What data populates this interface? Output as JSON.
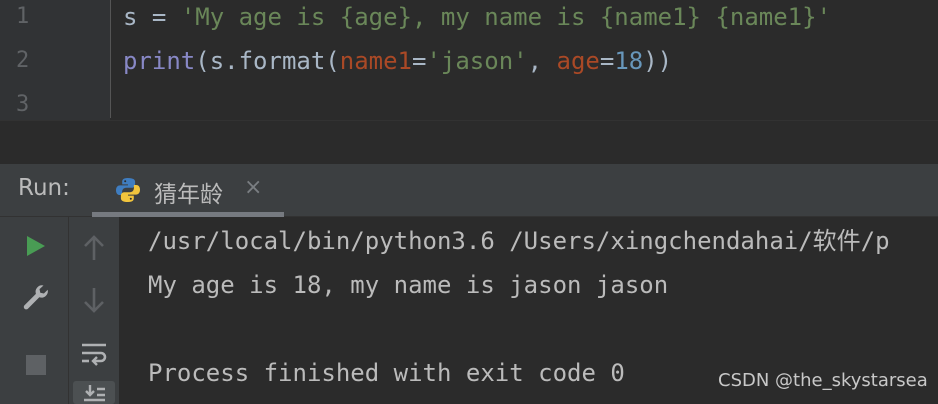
{
  "editor": {
    "line_numbers": [
      "1",
      "2",
      "3"
    ],
    "line1": {
      "var": "s",
      "op": " = ",
      "str": "'My age is {age}, my name is {name1} {name1}'"
    },
    "line2": {
      "func": "print",
      "p1": "(s.format(",
      "kw1": "name1",
      "eq1": "=",
      "str1": "'jason'",
      "comma": ", ",
      "kw2": "age",
      "eq2": "=",
      "num": "18",
      "close": "))"
    }
  },
  "run_window": {
    "title": "Run:",
    "tab_label": "猜年龄",
    "tab_close": "×",
    "tab_icon": "python-icon"
  },
  "toolbar": {
    "run_icon": "play-icon",
    "settings_icon": "wrench-icon",
    "stop_icon": "stop-icon",
    "up_icon": "arrow-up-icon",
    "down_icon": "arrow-down-icon",
    "wrap_icon": "soft-wrap-icon",
    "scroll_icon": "scroll-to-end-icon"
  },
  "console": {
    "lines": [
      "/usr/local/bin/python3.6 /Users/xingchendahai/软件/p",
      "My age is 18, my name is jason jason",
      "",
      "Process finished with exit code 0"
    ]
  },
  "watermark": "CSDN @the_skystarsea",
  "colors": {
    "run_green": "#499c54",
    "string_green": "#6a8759",
    "keyword_orange": "#aa4926",
    "number_blue": "#6897bb",
    "builtin_purple": "#8888c6"
  }
}
